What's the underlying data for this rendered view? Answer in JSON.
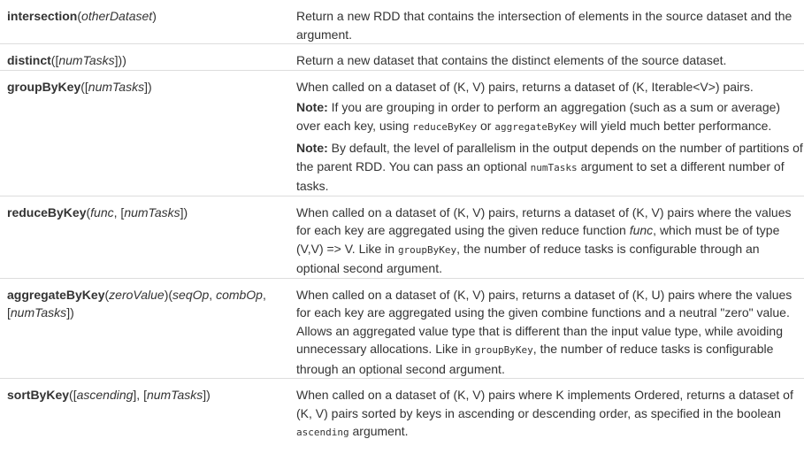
{
  "rows": [
    {
      "name": "intersection",
      "sig_open": "(",
      "arg1": "otherDataset",
      "sig_close": ")",
      "desc": "Return a new RDD that contains the intersection of elements in the source dataset and the argument."
    },
    {
      "name": "distinct",
      "sig_open": "([",
      "arg1": "numTasks",
      "sig_close": "]))",
      "desc": "Return a new dataset that contains the distinct elements of the source dataset."
    },
    {
      "name": "groupByKey",
      "sig_open": "([",
      "arg1": "numTasks",
      "sig_close": "])",
      "desc1": "When called on a dataset of (K, V) pairs, returns a dataset of (K, Iterable<V>) pairs.",
      "note_label": "Note:",
      "note1_a": " If you are grouping in order to perform an aggregation (such as a sum or average) over each key, using ",
      "note1_code1": "reduceByKey",
      "note1_b": " or ",
      "note1_code2": "aggregateByKey",
      "note1_c": " will yield much better performance.",
      "note2_a": " By default, the level of parallelism in the output depends on the number of partitions of the parent RDD. You can pass an optional ",
      "note2_code": "numTasks",
      "note2_b": " argument to set a different number of tasks."
    },
    {
      "name": "reduceByKey",
      "sig_open": "(",
      "arg1": "func",
      "sig_mid": ", [",
      "arg2": "numTasks",
      "sig_close": "])",
      "desc_a": "When called on a dataset of (K, V) pairs, returns a dataset of (K, V) pairs where the values for each key are aggregated using the given reduce function ",
      "desc_func": "func",
      "desc_b": ", which must be of type (V,V) => V. Like in ",
      "desc_code": "groupByKey",
      "desc_c": ", the number of reduce tasks is configurable through an optional second argument."
    },
    {
      "name": "aggregateByKey",
      "sig_open": "(",
      "arg1": "zeroValue",
      "sig_mid1": ")(",
      "arg2": "seqOp",
      "sig_mid2": ", ",
      "arg3": "combOp",
      "sig_mid3": ", [",
      "arg4": "numTasks",
      "sig_close": "])",
      "desc_a": "When called on a dataset of (K, V) pairs, returns a dataset of (K, U) pairs where the values for each key are aggregated using the given combine functions and a neutral \"zero\" value. Allows an aggregated value type that is different than the input value type, while avoiding unnecessary allocations. Like in ",
      "desc_code": "groupByKey",
      "desc_b": ", the number of reduce tasks is configurable through an optional second argument."
    },
    {
      "name": "sortByKey",
      "sig_open": "([",
      "arg1": "ascending",
      "sig_mid": "], [",
      "arg2": "numTasks",
      "sig_close": "])",
      "desc_a": "When called on a dataset of (K, V) pairs where K implements Ordered, returns a dataset of (K, V) pairs sorted by keys in ascending or descending order, as specified in the boolean ",
      "desc_code": "ascending",
      "desc_b": " argument."
    }
  ]
}
